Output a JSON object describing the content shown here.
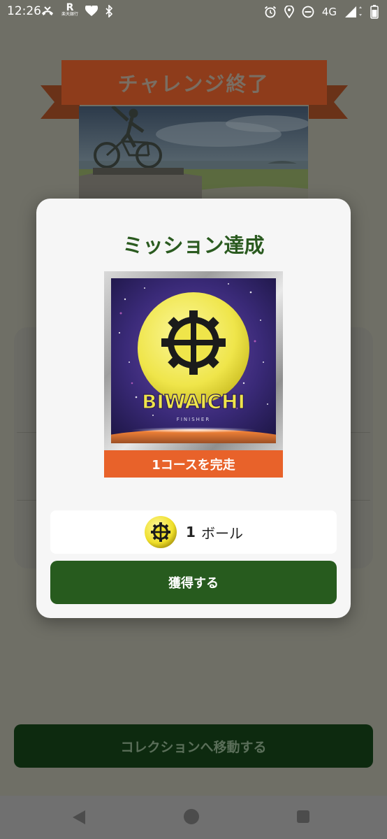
{
  "status_bar": {
    "time": "12:26",
    "network": "4G",
    "left_icons": [
      "missed-call-icon",
      "rakuten-bank-icon",
      "heart-icon",
      "bluetooth-icon"
    ],
    "right_icons": [
      "alarm-icon",
      "location-icon",
      "do-not-disturb-icon",
      "signal-icon",
      "battery-icon"
    ],
    "rakuten_letter": "R",
    "rakuten_text": "楽天銀行"
  },
  "background": {
    "ribbon_title": "チャレンジ終了",
    "collection_button_label": "コレクションへ移動する"
  },
  "modal": {
    "title": "ミッション達成",
    "badge": {
      "name": "BIWAICHI",
      "subtitle": "FINISHER",
      "caption": "1コースを完走"
    },
    "reward": {
      "quantity": "1",
      "unit": "ボール"
    },
    "acquire_button_label": "獲得する"
  },
  "colors": {
    "accent_green": "#275b1e",
    "title_green": "#2a5a1f",
    "caption_orange": "#e8622a",
    "ribbon_red": "#9c3b16"
  },
  "nav_bar": [
    "back-icon",
    "home-icon",
    "recent-apps-icon"
  ]
}
